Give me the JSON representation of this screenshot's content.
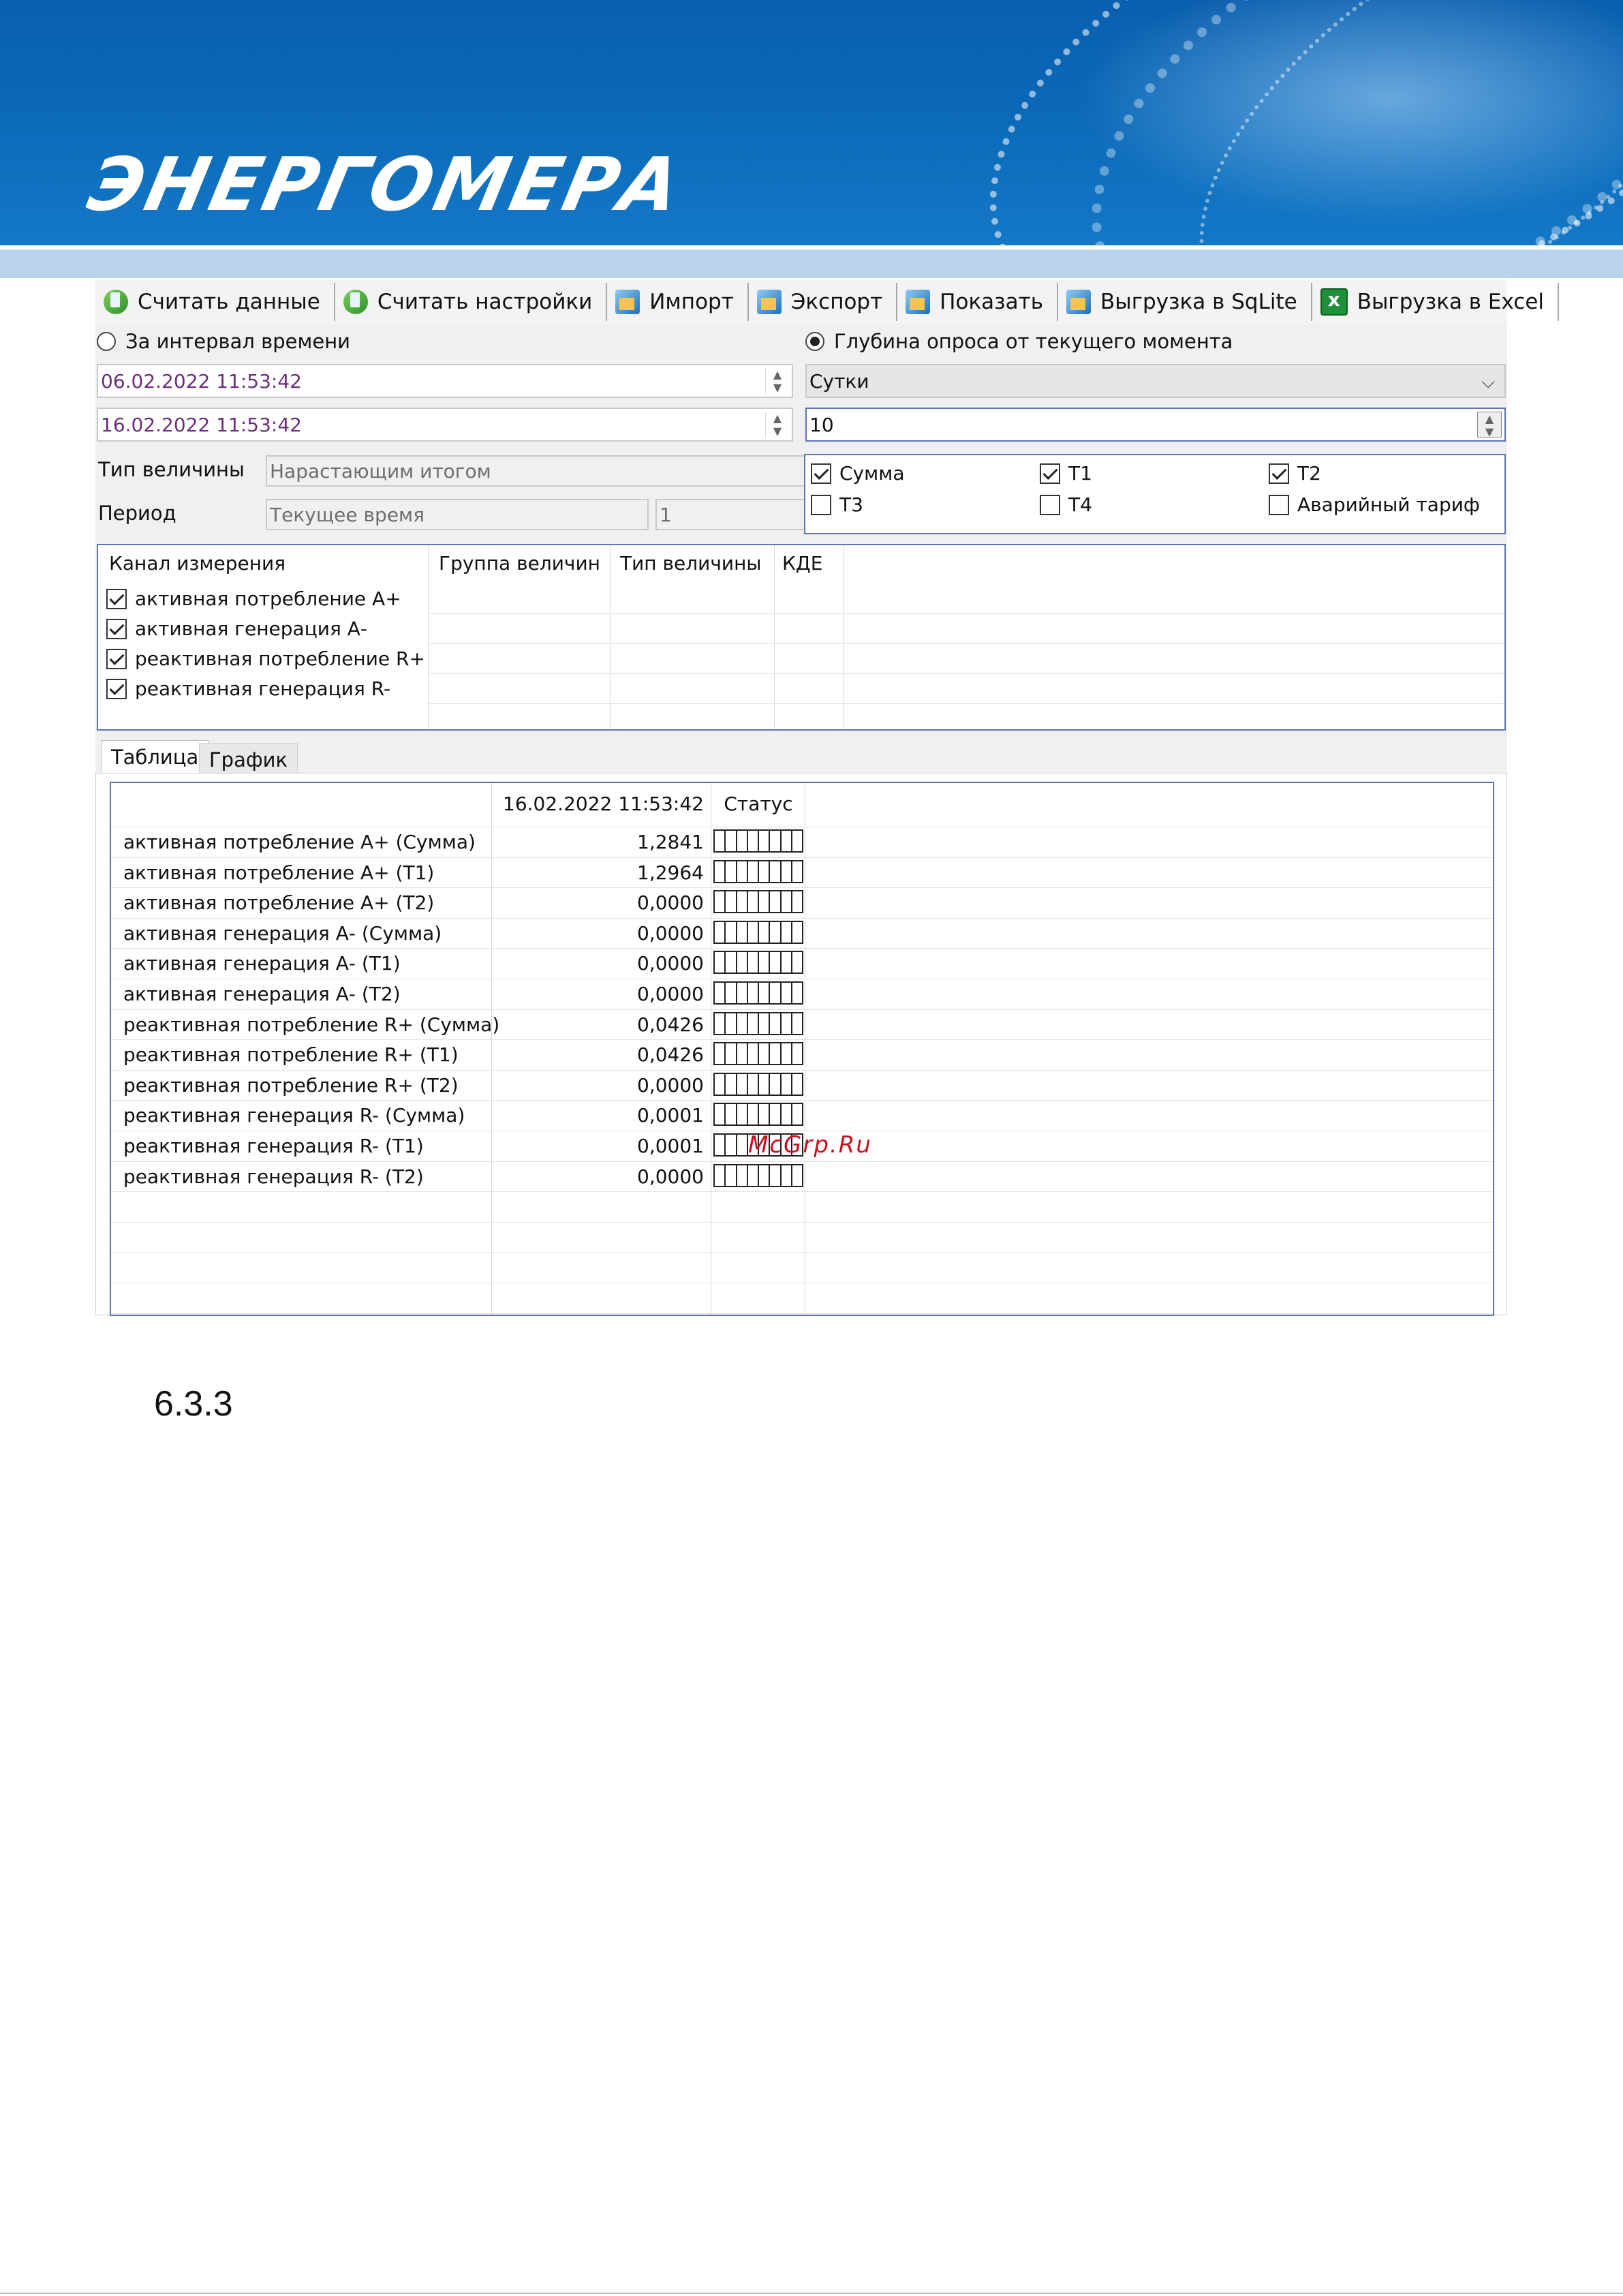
{
  "banner": {
    "logo_text": "ЭНЕРГОМЕРА"
  },
  "toolbar": {
    "buttons": [
      {
        "label": "Считать данные",
        "icon": "download-icon"
      },
      {
        "label": "Считать настройки",
        "icon": "download-settings-icon"
      },
      {
        "label": "Импорт",
        "icon": "import-icon"
      },
      {
        "label": "Экспорт",
        "icon": "export-icon"
      },
      {
        "label": "Показать",
        "icon": "show-icon"
      },
      {
        "label": "Выгрузка в SqLite",
        "icon": "sqlite-export-icon"
      },
      {
        "label": "Выгрузка в Excel",
        "icon": "excel-icon"
      }
    ]
  },
  "mode": {
    "interval_label": "За интервал времени",
    "interval_selected": false,
    "depth_label": "Глубина опроса от текущего момента",
    "depth_selected": true
  },
  "interval": {
    "from": "06.02.2022 11:53:42",
    "to": "16.02.2022 11:53:42"
  },
  "depth": {
    "unit": "Сутки",
    "count": "10"
  },
  "value_type": {
    "label": "Тип величины",
    "value": "Нарастающим итогом"
  },
  "period": {
    "label": "Период",
    "value": "Текущее время",
    "step": "1"
  },
  "tariffs": [
    {
      "label": "Сумма",
      "checked": true
    },
    {
      "label": "Т1",
      "checked": true
    },
    {
      "label": "Т2",
      "checked": true
    },
    {
      "label": "Т3",
      "checked": false
    },
    {
      "label": "Т4",
      "checked": false
    },
    {
      "label": "Аварийный тариф",
      "checked": false
    }
  ],
  "channels": {
    "headers": [
      "Канал измерения",
      "Группа величин",
      "Тип величины",
      "КДЕ"
    ],
    "rows": [
      {
        "label": "активная потребление А+",
        "checked": true
      },
      {
        "label": "активная генерация А-",
        "checked": true
      },
      {
        "label": "реактивная потребление R+",
        "checked": true
      },
      {
        "label": "реактивная генерация R-",
        "checked": true
      }
    ]
  },
  "tabs": [
    {
      "label": "Таблица",
      "active": true
    },
    {
      "label": "График",
      "active": false
    }
  ],
  "results": {
    "col_time": "16.02.2022 11:53:42",
    "col_status": "Статус",
    "rows": [
      {
        "name": "активная потребление А+ (Сумма)",
        "value": "1,2841"
      },
      {
        "name": "активная потребление А+ (Т1)",
        "value": "1,2964"
      },
      {
        "name": "активная потребление А+ (Т2)",
        "value": "0,0000"
      },
      {
        "name": "активная генерация А- (Сумма)",
        "value": "0,0000"
      },
      {
        "name": "активная генерация А- (Т1)",
        "value": "0,0000"
      },
      {
        "name": "активная генерация А- (Т2)",
        "value": "0,0000"
      },
      {
        "name": "реактивная потребление R+ (Сумма)",
        "value": "0,0426"
      },
      {
        "name": "реактивная потребление R+ (Т1)",
        "value": "0,0426"
      },
      {
        "name": "реактивная потребление R+ (Т2)",
        "value": "0,0000"
      },
      {
        "name": "реактивная генерация R- (Сумма)",
        "value": "0,0001"
      },
      {
        "name": "реактивная генерация R- (Т1)",
        "value": "0,0001"
      },
      {
        "name": "реактивная генерация R- (Т2)",
        "value": "0,0000"
      }
    ]
  },
  "watermark": "McGrp.Ru",
  "section_number": "6.3.3",
  "colors": {
    "banner_blue": "#0b69b8",
    "stripe": "#b9d3ec",
    "group_border": "#5b76b3",
    "date_text": "#6b2e7a",
    "watermark": "#c8101e"
  }
}
